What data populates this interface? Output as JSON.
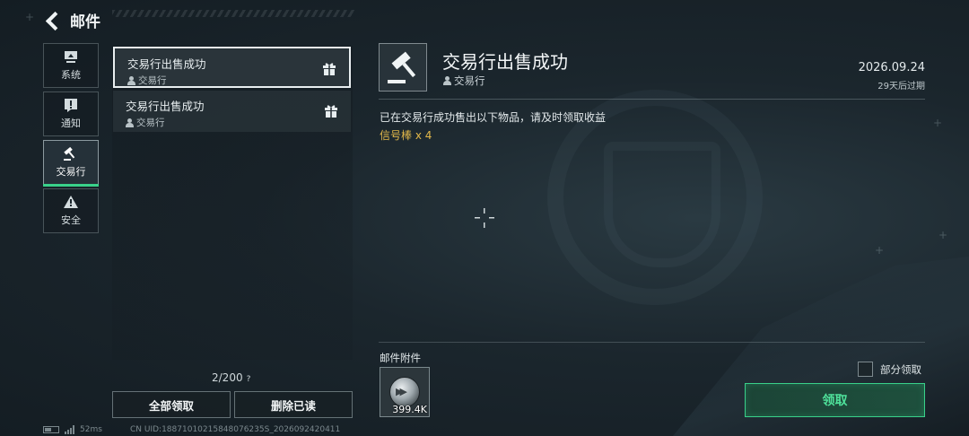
{
  "header": {
    "title": "邮件",
    "back_icon": "back-arrow-icon"
  },
  "categories": [
    {
      "label": "系统",
      "icon": "monitor-icon",
      "active": false
    },
    {
      "label": "通知",
      "icon": "exclamation-icon",
      "active": false
    },
    {
      "label": "交易行",
      "icon": "gavel-icon",
      "active": true
    },
    {
      "label": "安全",
      "icon": "warning-icon",
      "active": false
    }
  ],
  "mail_list": {
    "items": [
      {
        "title": "交易行出售成功",
        "sender": "交易行",
        "icon": "gift-icon",
        "selected": true
      },
      {
        "title": "交易行出售成功",
        "sender": "交易行",
        "icon": "gift-icon",
        "selected": false
      }
    ],
    "count": "2/200",
    "help": "?",
    "claim_all_label": "全部领取",
    "delete_read_label": "删除已读"
  },
  "footer": {
    "ping": "52ms",
    "uid": "CN UID:18871010215848076235S_2026092420411"
  },
  "detail": {
    "icon": "gavel-icon",
    "title": "交易行出售成功",
    "sender": "交易行",
    "date": "2026.09.24",
    "expire": "29天后过期",
    "body": "已在交易行成功售出以下物品，请及时领取收益",
    "item_line": "信号棒 x 4",
    "attachments_label": "邮件附件",
    "attachment": {
      "icon": "currency-coin-icon",
      "quantity": "399.4K"
    },
    "partial_claim_label": "部分领取",
    "claim_label": "领取"
  },
  "colors": {
    "accent_green": "#39d18a",
    "item_gold": "#e2b84a"
  }
}
